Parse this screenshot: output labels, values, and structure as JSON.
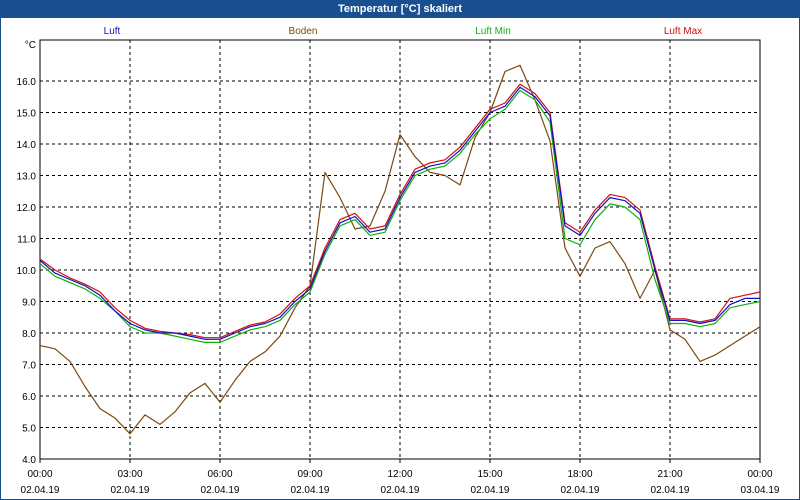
{
  "window": {
    "title": "Temperatur [°C] skaliert"
  },
  "chart_data": {
    "type": "line",
    "title": "Temperatur [°C] skaliert",
    "ylabel": "°C",
    "xlabel": "",
    "ylim": [
      4.0,
      17.0
    ],
    "xlim": [
      0,
      24
    ],
    "grid": true,
    "legend_position": "top",
    "y_ticks": [
      "4.0",
      "5.0",
      "6.0",
      "7.0",
      "8.0",
      "9.0",
      "10.0",
      "11.0",
      "12.0",
      "13.0",
      "14.0",
      "15.0",
      "16.0"
    ],
    "x_ticks": [
      {
        "time": "00:00",
        "date": "02.04.19"
      },
      {
        "time": "03:00",
        "date": "02.04.19"
      },
      {
        "time": "06:00",
        "date": "02.04.19"
      },
      {
        "time": "09:00",
        "date": "02.04.19"
      },
      {
        "time": "12:00",
        "date": "02.04.19"
      },
      {
        "time": "15:00",
        "date": "02.04.19"
      },
      {
        "time": "18:00",
        "date": "02.04.19"
      },
      {
        "time": "21:00",
        "date": "02.04.19"
      },
      {
        "time": "00:00",
        "date": "03.04.19"
      }
    ],
    "x": [
      0,
      0.5,
      1,
      1.5,
      2,
      2.5,
      3,
      3.5,
      4,
      4.5,
      5,
      5.5,
      6,
      6.5,
      7,
      7.5,
      8,
      8.5,
      9,
      9.5,
      10,
      10.5,
      11,
      11.5,
      12,
      12.5,
      13,
      13.5,
      14,
      14.5,
      15,
      15.5,
      16,
      16.5,
      17,
      17.5,
      18,
      18.5,
      19,
      19.5,
      20,
      20.5,
      21,
      21.5,
      22,
      22.5,
      23,
      23.5,
      24
    ],
    "series": [
      {
        "name": "Luft",
        "color": "#1010c0",
        "values": [
          10.3,
          9.9,
          9.7,
          9.5,
          9.2,
          8.7,
          8.3,
          8.1,
          8.0,
          8.0,
          7.9,
          7.8,
          7.8,
          8.0,
          8.2,
          8.3,
          8.5,
          9.0,
          9.4,
          10.6,
          11.5,
          11.7,
          11.2,
          11.3,
          12.3,
          13.1,
          13.3,
          13.4,
          13.8,
          14.4,
          15.0,
          15.2,
          15.8,
          15.5,
          14.9,
          11.4,
          11.1,
          11.8,
          12.3,
          12.2,
          11.8,
          10.0,
          8.4,
          8.4,
          8.3,
          8.4,
          8.9,
          9.1,
          9.1
        ]
      },
      {
        "name": "Boden",
        "color": "#7a4a10",
        "values": [
          7.6,
          7.5,
          7.1,
          6.3,
          5.6,
          5.3,
          4.8,
          5.4,
          5.1,
          5.5,
          6.1,
          6.4,
          5.8,
          6.5,
          7.1,
          7.4,
          7.9,
          8.8,
          9.5,
          13.1,
          12.3,
          11.3,
          11.4,
          12.5,
          14.3,
          13.6,
          13.1,
          13.0,
          12.7,
          14.2,
          15.0,
          16.3,
          16.5,
          15.4,
          14.1,
          10.7,
          9.8,
          10.7,
          10.9,
          10.2,
          9.1,
          10.0,
          8.1,
          7.8,
          7.1,
          7.3,
          7.6,
          7.9,
          8.2
        ]
      },
      {
        "name": "Luft Min",
        "color": "#10b010",
        "values": [
          10.2,
          9.8,
          9.6,
          9.4,
          9.1,
          8.7,
          8.2,
          8.0,
          8.0,
          7.9,
          7.8,
          7.7,
          7.7,
          7.9,
          8.1,
          8.2,
          8.4,
          8.9,
          9.3,
          10.5,
          11.4,
          11.6,
          11.1,
          11.2,
          12.2,
          13.0,
          13.2,
          13.3,
          13.7,
          14.3,
          14.8,
          15.1,
          15.7,
          15.4,
          14.7,
          11.0,
          10.8,
          11.6,
          12.1,
          12.0,
          11.6,
          9.7,
          8.3,
          8.3,
          8.2,
          8.3,
          8.8,
          8.9,
          9.0
        ]
      },
      {
        "name": "Luft Max",
        "color": "#d01010",
        "values": [
          10.35,
          10.0,
          9.75,
          9.55,
          9.3,
          8.8,
          8.4,
          8.15,
          8.05,
          8.0,
          7.95,
          7.85,
          7.85,
          8.05,
          8.25,
          8.35,
          8.6,
          9.1,
          9.5,
          10.7,
          11.6,
          11.8,
          11.3,
          11.4,
          12.4,
          13.2,
          13.4,
          13.5,
          13.9,
          14.5,
          15.1,
          15.3,
          15.9,
          15.6,
          15.0,
          11.5,
          11.2,
          11.9,
          12.4,
          12.3,
          11.9,
          10.1,
          8.45,
          8.45,
          8.35,
          8.45,
          9.1,
          9.2,
          9.3
        ]
      }
    ]
  }
}
